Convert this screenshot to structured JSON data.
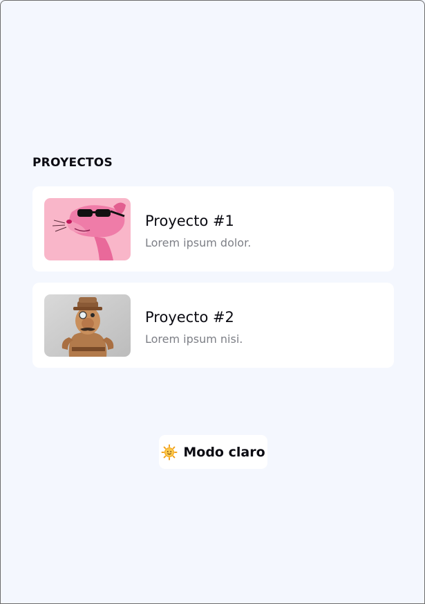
{
  "section": {
    "title": "PROYECTOS"
  },
  "projects": [
    {
      "title": "Proyecto #1",
      "description": "Lorem ipsum dolor.",
      "image": "pink-panther-with-sunglasses"
    },
    {
      "title": "Proyecto #2",
      "description": "Lorem ipsum nisi.",
      "image": "detective-cartoon-figure"
    }
  ],
  "theme_toggle": {
    "label": "Modo claro",
    "icon": "sun-icon"
  },
  "colors": {
    "background": "#f4f7fe",
    "card": "#ffffff",
    "title": "#0b0b12",
    "muted": "#7d7f86",
    "pink_thumb": "#f9b6c9"
  }
}
